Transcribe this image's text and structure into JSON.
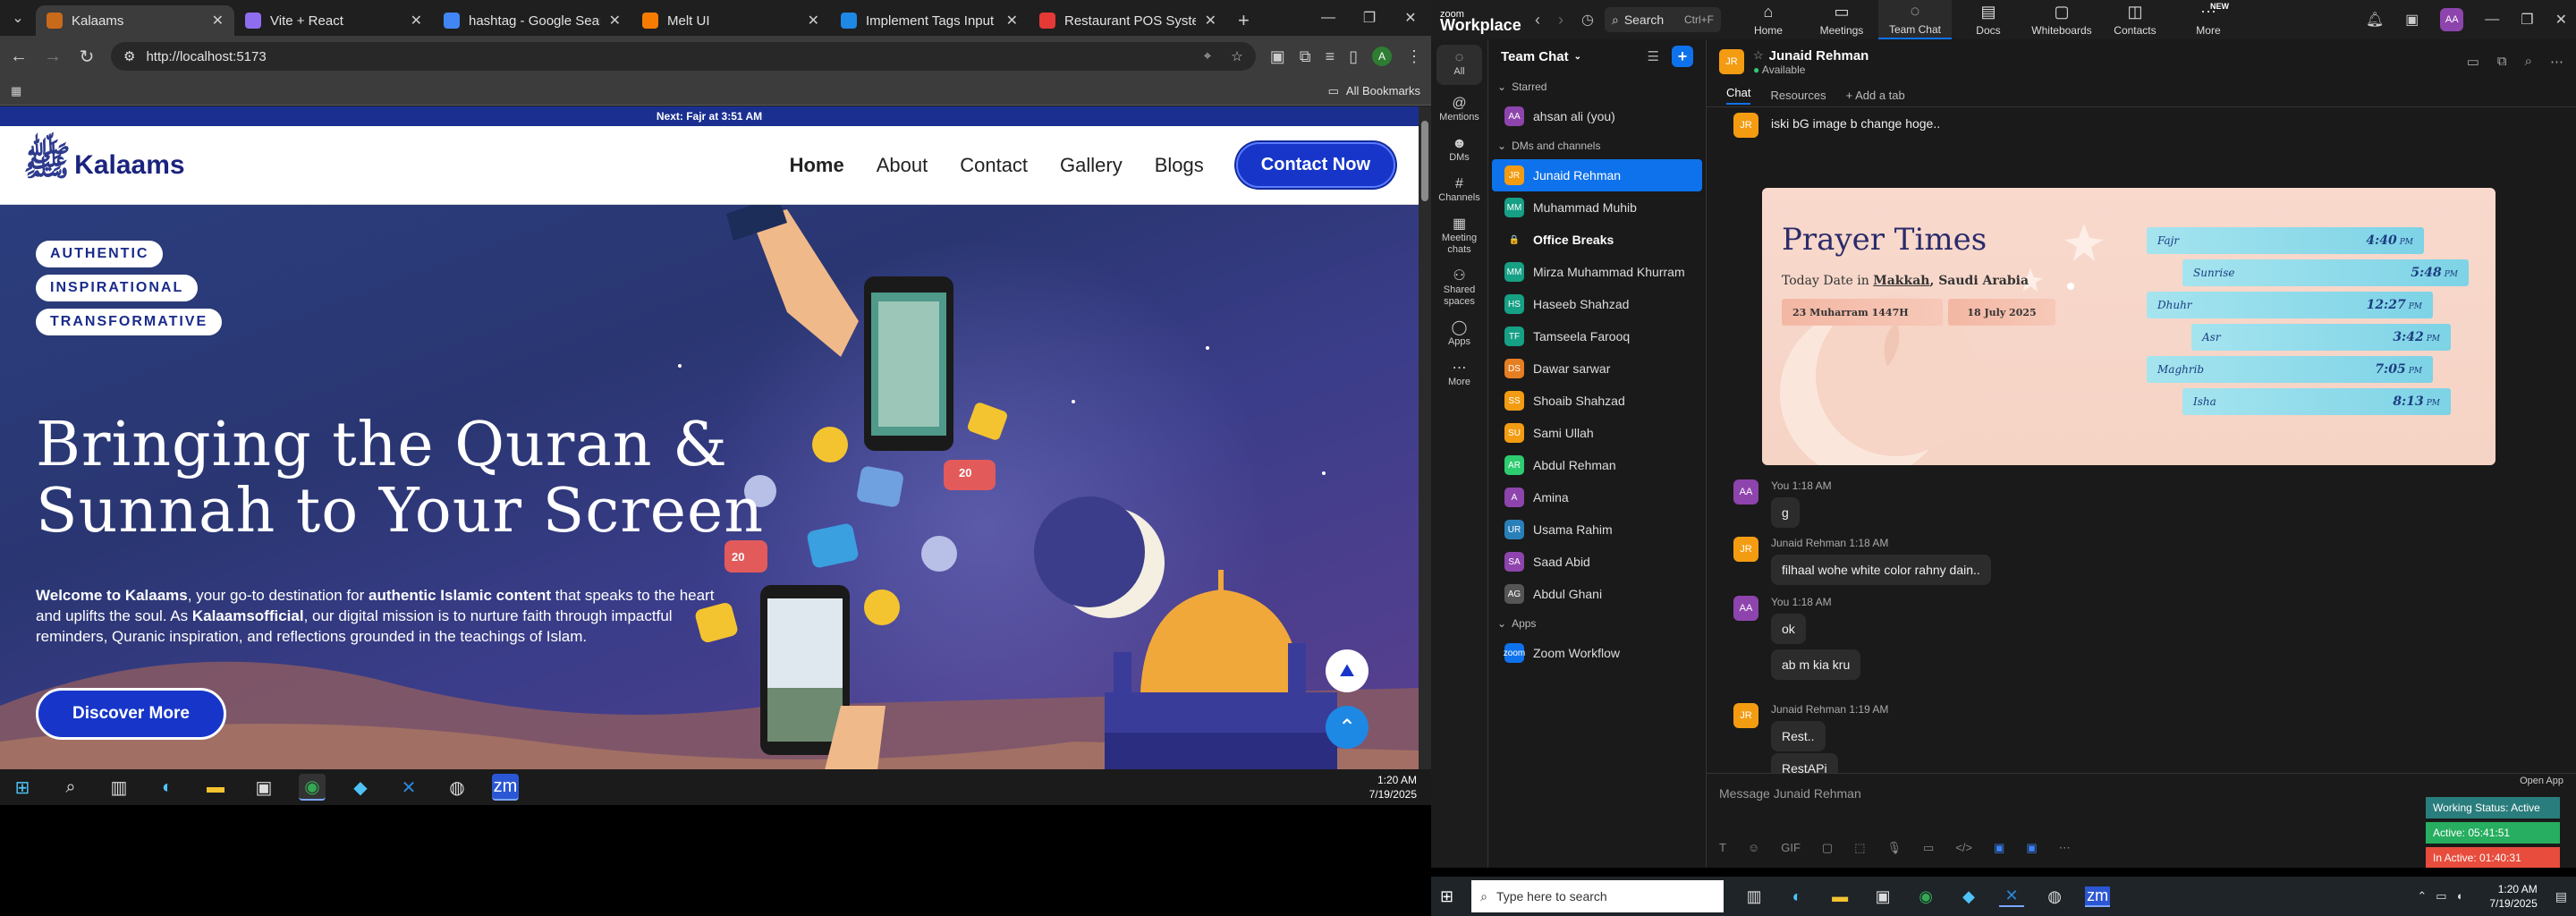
{
  "browser": {
    "tabs": [
      {
        "title": "Kalaams",
        "color": "#c86a1a",
        "active": true
      },
      {
        "title": "Vite + React",
        "color": "#8e6df0",
        "active": false
      },
      {
        "title": "hashtag - Google Search",
        "color": "#4285f4",
        "active": false
      },
      {
        "title": "Melt UI",
        "color": "#f57c00",
        "active": false
      },
      {
        "title": "Implement Tags Input in Blo",
        "color": "#1e88e5",
        "active": false
      },
      {
        "title": "Restaurant POS System with",
        "color": "#e53935",
        "active": false
      }
    ],
    "new_tab": "+",
    "url": "http://localhost:5173",
    "bookmarks_label": "All Bookmarks",
    "profile_initial": "A"
  },
  "site": {
    "next_prayer": "Next: Fajr at 3:51 AM",
    "logo_mark": "ﷺ",
    "logo_word": "Kalaams",
    "nav": [
      {
        "label": "Home",
        "active": true
      },
      {
        "label": "About",
        "active": false
      },
      {
        "label": "Contact",
        "active": false
      },
      {
        "label": "Gallery",
        "active": false
      },
      {
        "label": "Blogs",
        "active": false
      }
    ],
    "contact_btn": "Contact Now",
    "pills": [
      "AUTHENTIC",
      "INSPIRATIONAL",
      "TRANSFORMATIVE"
    ],
    "headline": "Bringing the Quran & Sunnah to Your Screen",
    "para": {
      "p1": "Welcome to Kalaams",
      "p2": ", your go-to destination for ",
      "p3": "authentic Islamic content",
      "p4": " that speaks to the heart and uplifts the soul. As ",
      "p5": "Kalaamsofficial",
      "p6": ", our digital mission is to nurture faith through impactful reminders, Quranic inspiration, and reflections grounded in the teachings of Islam."
    },
    "discover_btn": "Discover More",
    "hero_badges": {
      "likes": "20",
      "hearts": "20"
    }
  },
  "left_taskbar": {
    "time": "1:20 AM",
    "date": "7/19/2025"
  },
  "zoom": {
    "logo_top": "zoom",
    "logo_bottom": "Workplace",
    "search_label": "Search",
    "search_shortcut": "Ctrl+F",
    "nav": [
      {
        "label": "Home",
        "icon": "⌂",
        "active": false
      },
      {
        "label": "Meetings",
        "icon": "▭",
        "active": false
      },
      {
        "label": "Team Chat",
        "icon": "◌",
        "active": true
      },
      {
        "label": "Docs",
        "icon": "▤",
        "active": false
      },
      {
        "label": "Whiteboards",
        "icon": "▢",
        "active": false
      },
      {
        "label": "Contacts",
        "icon": "◫",
        "active": false
      },
      {
        "label": "More",
        "icon": "⋯",
        "active": false,
        "badge": "NEW"
      }
    ],
    "user_initials": "AA",
    "rail": [
      {
        "label": "All",
        "icon": "◌",
        "active": true
      },
      {
        "label": "Mentions",
        "icon": "@",
        "active": false
      },
      {
        "label": "DMs",
        "icon": "☻",
        "active": false
      },
      {
        "label": "Channels",
        "icon": "#",
        "active": false
      },
      {
        "label": "Meeting chats",
        "icon": "▦",
        "active": false
      },
      {
        "label": "Shared spaces",
        "icon": "⚇",
        "active": false
      },
      {
        "label": "Apps",
        "icon": "◯",
        "active": false
      },
      {
        "label": "More",
        "icon": "⋯",
        "active": false
      }
    ],
    "list_title": "Team Chat",
    "starred_label": "Starred",
    "starred": [
      {
        "name": "ahsan ali (you)",
        "initials": "AA",
        "color": "#8e44ad"
      }
    ],
    "dms_label": "DMs and channels",
    "contacts": [
      {
        "name": "Junaid Rehman",
        "initials": "JR",
        "color": "#f39c12",
        "selected": true,
        "bold": false
      },
      {
        "name": "Muhammad Muhib",
        "initials": "MM",
        "color": "#16a085",
        "selected": false,
        "bold": false
      },
      {
        "name": "Office Breaks",
        "initials": "🔒",
        "color": "#1a1a1a",
        "selected": false,
        "bold": true
      },
      {
        "name": "Mirza Muhammad Khurram",
        "initials": "MM",
        "color": "#16a085",
        "selected": false,
        "bold": false
      },
      {
        "name": "Haseeb Shahzad",
        "initials": "HS",
        "color": "#16a085",
        "selected": false,
        "bold": false
      },
      {
        "name": "Tamseela Farooq",
        "initials": "TF",
        "color": "#16a085",
        "selected": false,
        "bold": false
      },
      {
        "name": "Dawar sarwar",
        "initials": "DS",
        "color": "#e67e22",
        "selected": false,
        "bold": false
      },
      {
        "name": "Shoaib Shahzad",
        "initials": "SS",
        "color": "#f39c12",
        "selected": false,
        "bold": false
      },
      {
        "name": "Sami Ullah",
        "initials": "SU",
        "color": "#f39c12",
        "selected": false,
        "bold": false
      },
      {
        "name": "Abdul Rehman",
        "initials": "AR",
        "color": "#2ecc71",
        "selected": false,
        "bold": false
      },
      {
        "name": "Amina",
        "initials": "A",
        "color": "#8e44ad",
        "selected": false,
        "bold": false
      },
      {
        "name": "Usama Rahim",
        "initials": "UR",
        "color": "#2980b9",
        "selected": false,
        "bold": false
      },
      {
        "name": "Saad Abid",
        "initials": "SA",
        "color": "#8e44ad",
        "selected": false,
        "bold": false
      },
      {
        "name": "Abdul Ghani",
        "initials": "AG",
        "color": "#555555",
        "selected": false,
        "bold": false
      }
    ],
    "apps_label": "Apps",
    "apps": [
      {
        "name": "Zoom Workflow",
        "initials": "zoom",
        "color": "#0e72ed"
      }
    ],
    "chat": {
      "name": "Junaid Rehman",
      "status": "Available",
      "tabs": [
        "Chat",
        "Resources",
        "+ Add a tab"
      ],
      "first_text": "iski bG image b change hoge..",
      "prayer": {
        "title": "Prayer Times",
        "date_pre": "Today Date in ",
        "city": "Makkah",
        "country": ", Saudi Arabia",
        "hijri": "23 Muharram 1447H",
        "greg": "18 July 2025",
        "times": [
          {
            "name": "Fajr",
            "time": "4:40"
          },
          {
            "name": "Sunrise",
            "time": "5:48"
          },
          {
            "name": "Dhuhr",
            "time": "12:27"
          },
          {
            "name": "Asr",
            "time": "3:42"
          },
          {
            "name": "Maghrib",
            "time": "7:05"
          },
          {
            "name": "Isha",
            "time": "8:13"
          }
        ],
        "pm": "PM"
      },
      "messages": [
        {
          "meta": "You 1:18 AM",
          "text": "g",
          "initials": "AA",
          "color": "#8e44ad"
        },
        {
          "meta": "Junaid Rehman 1:18 AM",
          "text": "filhaal wohe white color rahny dain..",
          "initials": "JR",
          "color": "#f39c12"
        },
        {
          "meta": "You 1:18 AM",
          "text": "ok",
          "initials": "AA",
          "color": "#8e44ad"
        },
        {
          "meta": "",
          "text": "ab m kia kru",
          "initials": "",
          "color": ""
        },
        {
          "meta": "Junaid Rehman 1:19 AM",
          "text": "Rest..",
          "initials": "JR",
          "color": "#f39c12"
        },
        {
          "meta": "",
          "text": "RestAPi",
          "initials": "",
          "color": ""
        }
      ],
      "composer_placeholder": "Message Junaid Rehman",
      "open_app": "Open App",
      "work_status": "Working Status: Active",
      "active_time": "Active: 05:41:51",
      "inactive_time": "In Active: 01:40:31"
    }
  },
  "right_taskbar": {
    "search_placeholder": "Type here to search",
    "time": "1:20 AM",
    "date": "7/19/2025"
  }
}
